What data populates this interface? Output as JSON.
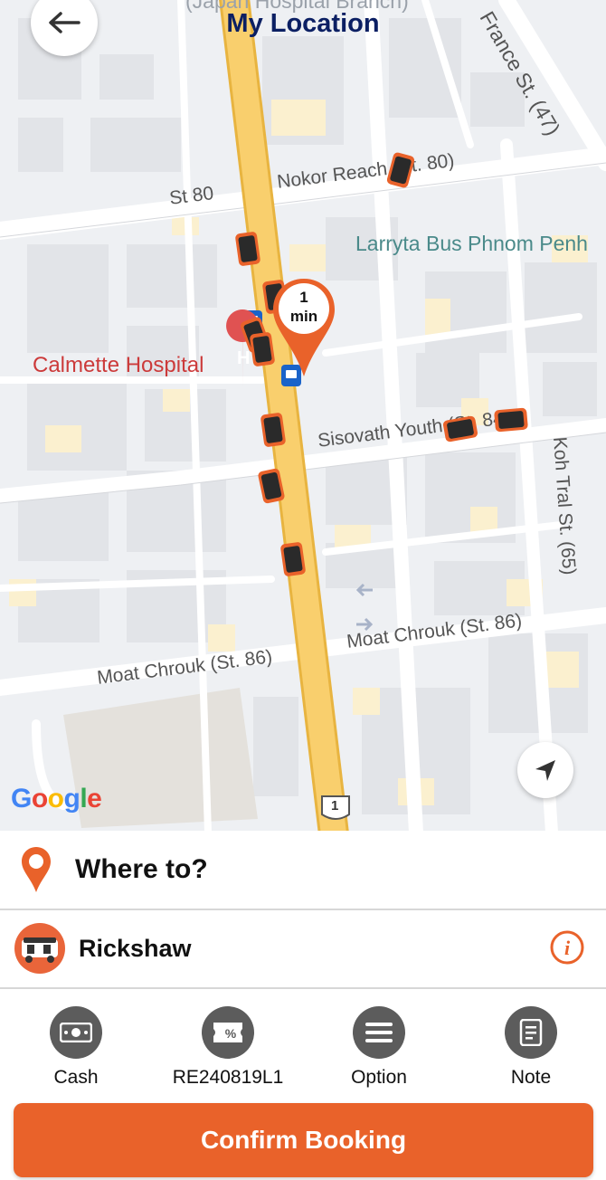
{
  "header": {
    "title": "My Location",
    "partial_top_label": "(Japan Hospital Branch)"
  },
  "map": {
    "labels": {
      "street_80": "St 80",
      "nokor_reach": "Nokor Reach (St. 80)",
      "larryta": "Larryta Bus Phnom Penh",
      "calmette": "Calmette Hospital",
      "sisovath": "Sisovath Youth (St. 84)",
      "koh_tral": "Koh Tral St. (65)",
      "moat_chrouk_left": "Moat Chrouk (St. 86)",
      "moat_chrouk_right": "Moat Chrouk (St. 86)",
      "france": "France St. (47)",
      "route_shield": "1"
    },
    "pin_eta_value": "1",
    "pin_eta_unit": "min",
    "google_logo": "Google",
    "colors": {
      "accent": "#e9622a",
      "road_main": "#f9cf6d",
      "title": "#0b1f63"
    }
  },
  "booking": {
    "where_to": "Where to?",
    "vehicle_label": "Rickshaw",
    "options": [
      {
        "label": "Cash",
        "icon": "cash-icon"
      },
      {
        "label": "RE240819L1",
        "icon": "promo-ticket-icon"
      },
      {
        "label": "Option",
        "icon": "menu-icon"
      },
      {
        "label": "Note",
        "icon": "note-icon"
      }
    ],
    "confirm_label": "Confirm Booking"
  }
}
